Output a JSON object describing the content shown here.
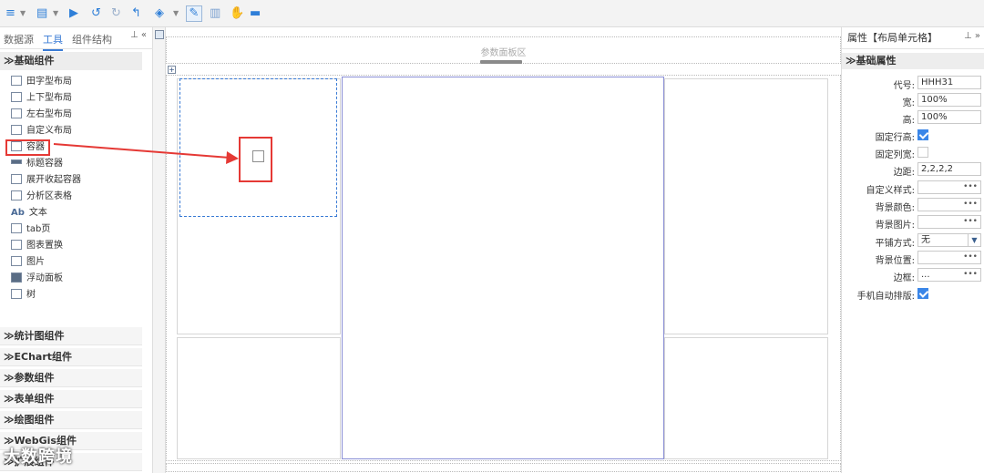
{
  "toolbar": {
    "icons": [
      "menu-icon",
      "save-icon",
      "run-icon",
      "undo-icon",
      "redo-icon",
      "back-icon",
      "paint-icon",
      "pen-icon",
      "delete-icon",
      "hand-icon",
      "window-icon"
    ],
    "glyphs": {
      "menu": "≡",
      "caret": "▼",
      "save": "▤",
      "run": "▶",
      "undo": "↺",
      "redo": "↻",
      "back": "↰",
      "paint": "◈",
      "pen": "✎",
      "delete": "▥",
      "hand": "✋",
      "window": "▬"
    }
  },
  "left_panel": {
    "tabs": [
      "数据源",
      "工具",
      "组件结构"
    ],
    "active_tab": "工具",
    "pin": "⊥ «",
    "basic_header": "≫基础组件",
    "items": [
      {
        "label": "田字型布局",
        "icon": "grid-layout-icon"
      },
      {
        "label": "上下型布局",
        "icon": "vertical-layout-icon"
      },
      {
        "label": "左右型布局",
        "icon": "horizontal-layout-icon"
      },
      {
        "label": "自定义布局",
        "icon": "custom-layout-icon"
      },
      {
        "label": "容器",
        "icon": "container-icon"
      },
      {
        "label": "标题容器",
        "icon": "title-container-icon"
      },
      {
        "label": "展开收起容器",
        "icon": "collapse-container-icon"
      },
      {
        "label": "分析区表格",
        "icon": "table-icon"
      },
      {
        "label": "文本",
        "icon": "text-icon"
      },
      {
        "label": "tab页",
        "icon": "tab-icon"
      },
      {
        "label": "图表置换",
        "icon": "chart-switch-icon"
      },
      {
        "label": "图片",
        "icon": "image-icon"
      },
      {
        "label": "浮动面板",
        "icon": "float-panel-icon"
      },
      {
        "label": "树",
        "icon": "tree-icon"
      }
    ],
    "categories": [
      "≫统计图组件",
      "≫EChart组件",
      "≫参数组件",
      "≫表单组件",
      "≫绘图组件",
      "≫WebGis组件",
      "≫扩展组件"
    ],
    "watermark": "大数跨境"
  },
  "canvas": {
    "param_panel_label": "参数面板区",
    "plus": "+"
  },
  "right_panel": {
    "title": "属性【布局单元格】",
    "pin": "⊥ »",
    "section": "≫基础属性",
    "props": [
      {
        "label": "代号:",
        "value": "HHH31",
        "kind": "text"
      },
      {
        "label": "宽:",
        "value": "100%",
        "kind": "text"
      },
      {
        "label": "高:",
        "value": "100%",
        "kind": "text"
      },
      {
        "label": "固定行高:",
        "value": "checked",
        "kind": "check"
      },
      {
        "label": "固定列宽:",
        "value": "unchecked",
        "kind": "check"
      },
      {
        "label": "边距:",
        "value": "2,2,2,2",
        "kind": "text"
      },
      {
        "label": "自定义样式:",
        "value": "",
        "kind": "more"
      },
      {
        "label": "背景颜色:",
        "value": "",
        "kind": "more"
      },
      {
        "label": "背景图片:",
        "value": "",
        "kind": "more"
      },
      {
        "label": "平铺方式:",
        "value": "无",
        "kind": "select"
      },
      {
        "label": "背景位置:",
        "value": "",
        "kind": "more"
      },
      {
        "label": "边框:",
        "value": "...",
        "kind": "more"
      },
      {
        "label": "手机自动排版:",
        "value": "checked",
        "kind": "check"
      }
    ],
    "more_glyph": "•••",
    "dropdown_glyph": "▼"
  },
  "colors": {
    "accent": "#3a7bd5",
    "highlight": "#e53935"
  }
}
